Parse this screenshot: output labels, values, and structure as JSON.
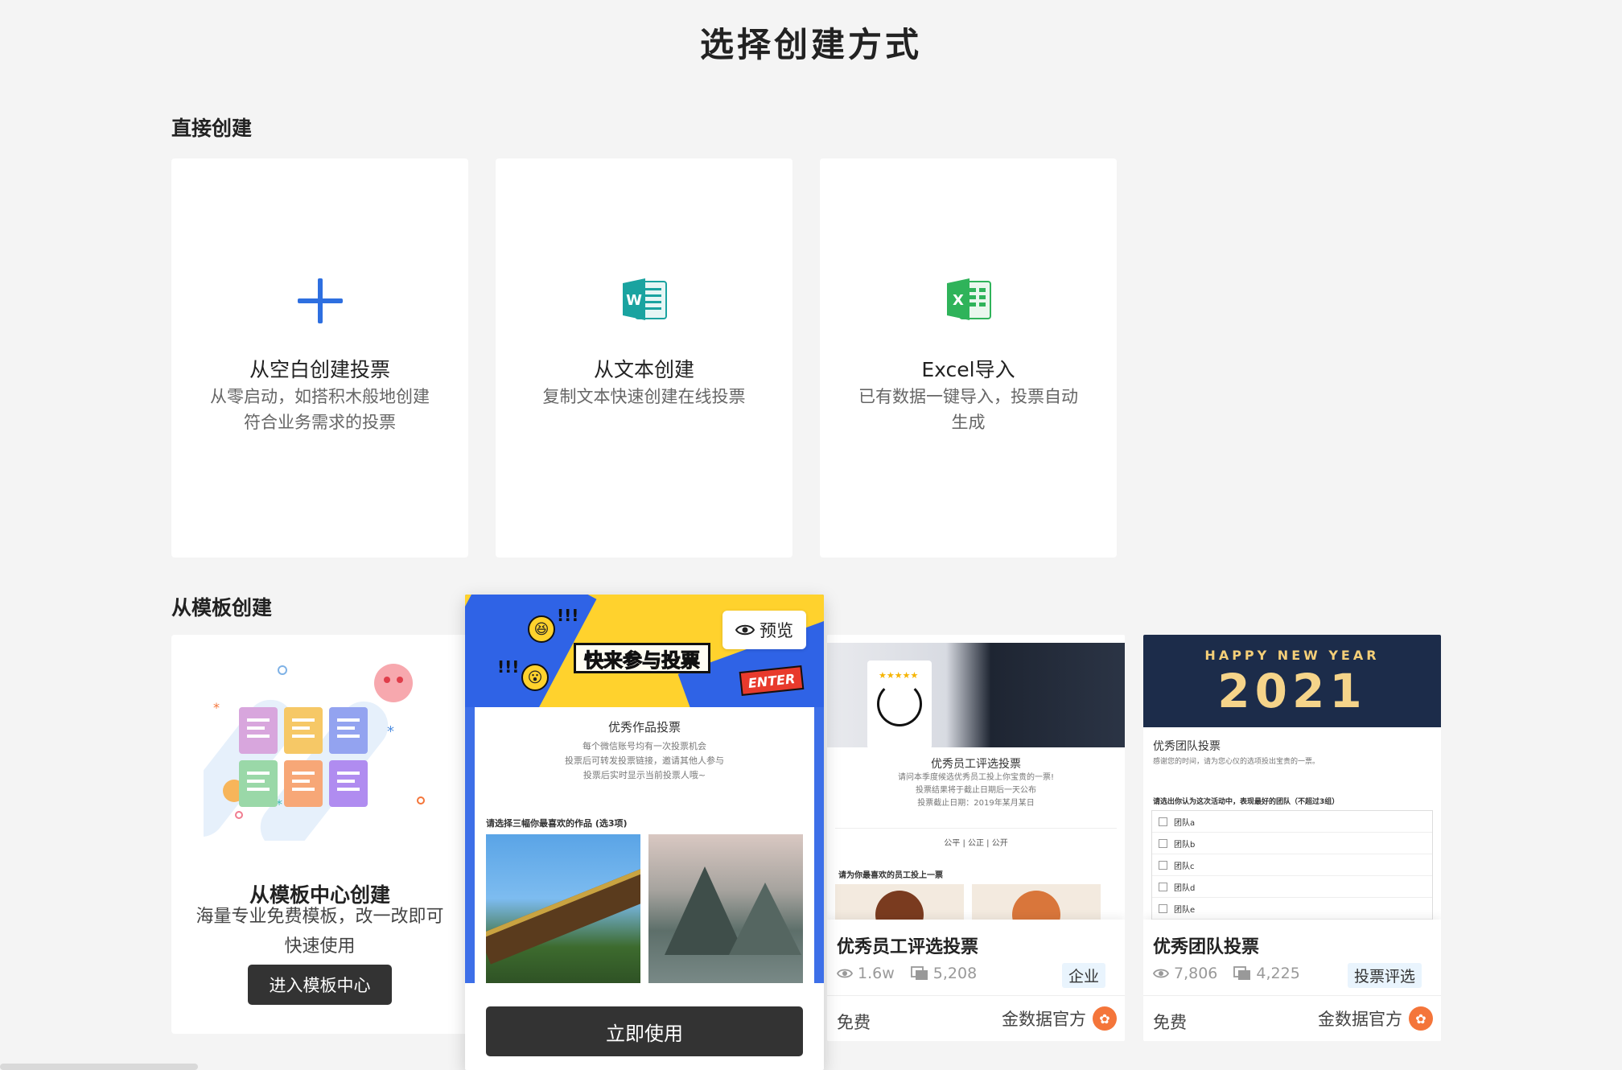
{
  "page": {
    "title": "选择创建方式"
  },
  "direct": {
    "heading": "直接创建",
    "cards": [
      {
        "title": "从空白创建投票",
        "desc": "从零启动，如搭积木般地创建符合业务需求的投票",
        "icon": "plus-icon"
      },
      {
        "title": "从文本创建",
        "desc": "复制文本快速创建在线投票",
        "icon": "word-doc-icon",
        "icon_letter": "W"
      },
      {
        "title": "Excel导入",
        "desc": "已有数据一键导入，投票自动生成",
        "icon": "excel-doc-icon",
        "icon_letter": "X"
      }
    ]
  },
  "template": {
    "heading": "从模板创建",
    "center": {
      "title": "从模板中心创建",
      "desc": "海量专业免费模板，改一改即可快速使用",
      "button": "进入模板中心"
    },
    "hover_card": {
      "preview_label": "预览",
      "banner_sign": "快来参与投票",
      "banner_enter": "ENTER",
      "form_title": "优秀作品投票",
      "form_desc": "每个微信账号均有一次投票机会\n投票后可转发投票链接，邀请其他人参与\n投票后实时显示当前投票人哦~",
      "question": "请选择三幅你最喜欢的作品 (选3项)",
      "use_button": "立即使用"
    },
    "cards": [
      {
        "title": "优秀员工评选投票",
        "views": "1.6w",
        "uses": "5,208",
        "tag": "企业",
        "price": "免费",
        "author": "金数据官方",
        "thumb": {
          "stars": "★★★★★",
          "form_title": "优秀员工评选投票",
          "form_desc": "请问本季度候选优秀员工投上你宝贵的一票!\n投票结果将于截止日期后一天公布\n投票截止日期：2019年某月某日",
          "subtitle": "公平 | 公正 | 公开",
          "question": "请为你最喜欢的员工投上一票"
        }
      },
      {
        "title": "优秀团队投票",
        "views": "7,806",
        "uses": "4,225",
        "tag": "投票评选",
        "price": "免费",
        "author": "金数据官方",
        "thumb": {
          "banner_top": "HAPPY NEW YEAR",
          "banner_year": "2021",
          "form_title": "优秀团队投票",
          "form_desc": "感谢您的时间，请为您心仪的选项投出宝贵的一票。",
          "question": "请选出你认为这次活动中，表现最好的团队（不超过3组）",
          "options": [
            "团队a",
            "团队b",
            "团队c",
            "团队d",
            "团队e"
          ]
        }
      }
    ]
  },
  "colors": {
    "accent_blue": "#2e6fe0",
    "word_teal": "#1aa3a0",
    "excel_green": "#2fb35a",
    "dark_button": "#333333",
    "logo_orange": "#f4753a"
  }
}
